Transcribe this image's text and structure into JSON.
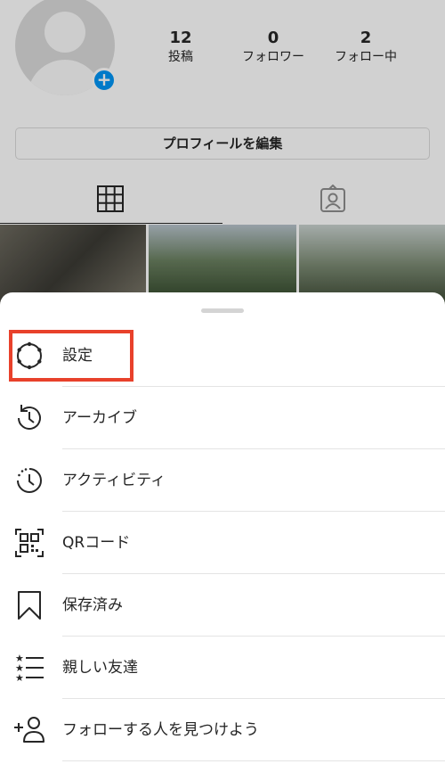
{
  "profile": {
    "stats": [
      {
        "value": "12",
        "label": "投稿"
      },
      {
        "value": "0",
        "label": "フォロワー"
      },
      {
        "value": "2",
        "label": "フォロー中"
      }
    ],
    "edit_button_label": "プロフィールを編集",
    "add_badge": "+"
  },
  "menu": {
    "items": [
      {
        "label": "設定",
        "icon": "settings-gear-icon"
      },
      {
        "label": "アーカイブ",
        "icon": "archive-history-icon"
      },
      {
        "label": "アクティビティ",
        "icon": "activity-clock-icon"
      },
      {
        "label": "QRコード",
        "icon": "qr-code-icon"
      },
      {
        "label": "保存済み",
        "icon": "bookmark-icon"
      },
      {
        "label": "親しい友達",
        "icon": "close-friends-list-icon"
      },
      {
        "label": "フォローする人を見つけよう",
        "icon": "add-person-icon"
      }
    ]
  },
  "colors": {
    "highlight": "#e8412b",
    "accent": "#0095f6"
  }
}
